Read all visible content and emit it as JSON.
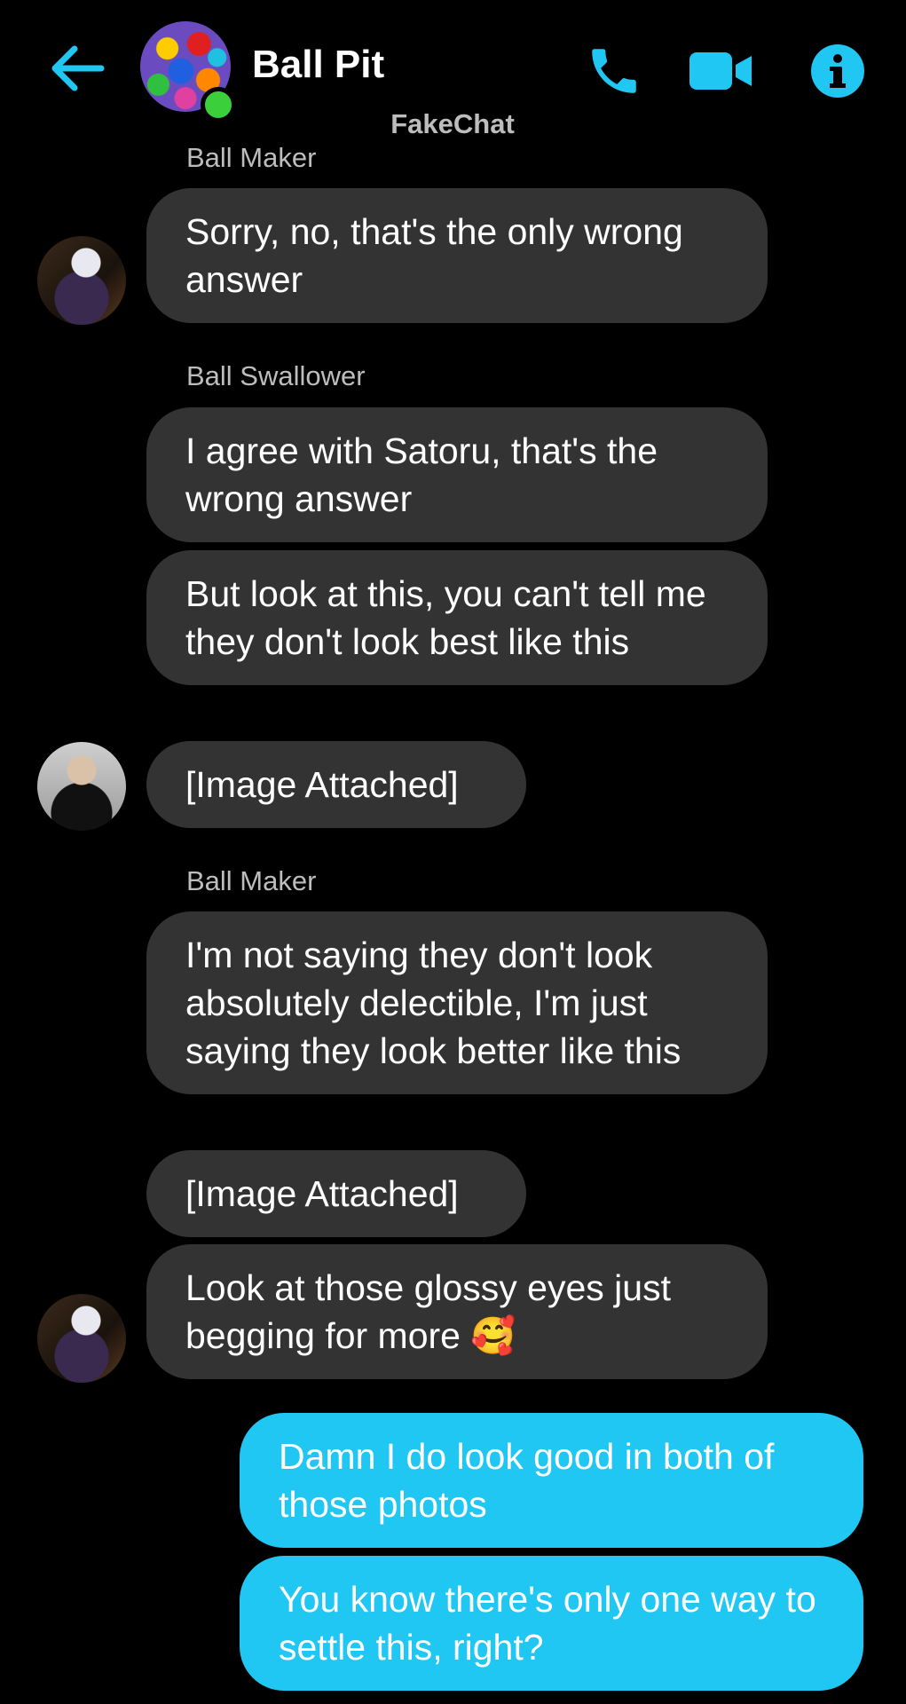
{
  "header": {
    "title": "Ball Pit",
    "watermark": "FakeChat",
    "back_icon": "arrow-left-icon",
    "call_icon": "phone-icon",
    "video_icon": "video-camera-icon",
    "info_icon": "info-icon"
  },
  "colors": {
    "accent": "#1fc7f2",
    "incoming_bubble": "#333333",
    "background": "#000000",
    "online": "#3ccf3c"
  },
  "messages": {
    "g1": {
      "sender": "Ball Maker",
      "m1": {
        "text": "Sorry, no, that's the only wrong answer"
      }
    },
    "g2": {
      "sender": "Ball Swallower",
      "m1": {
        "text": "I agree with Satoru, that's the wrong answer"
      },
      "m2": {
        "text": "But look at this, you can't tell me they don't look best like this"
      },
      "m3": {
        "text": "[Image Attached]"
      }
    },
    "g3": {
      "sender": "Ball Maker",
      "m1": {
        "text": "I'm not saying they don't look absolutely delectible, I'm just saying they look better like this"
      },
      "m2": {
        "text": "[Image Attached]"
      },
      "m3": {
        "text": "Look at those glossy eyes just begging for more 🥰"
      }
    },
    "out": {
      "m1": {
        "text": "Damn I do look good in both of those photos"
      },
      "m2": {
        "text": "You know there's only one way to settle this, right?"
      }
    }
  }
}
